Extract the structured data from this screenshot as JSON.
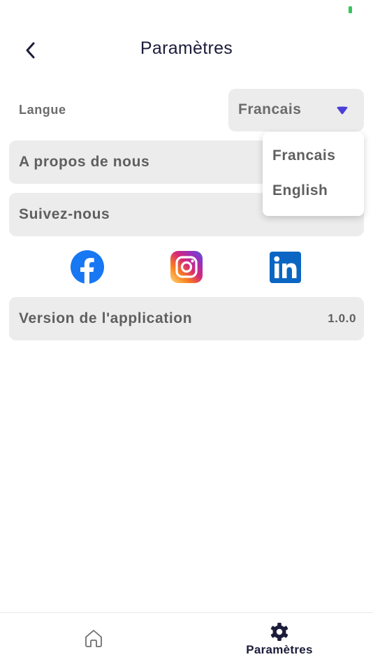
{
  "header": {
    "title": "Paramètres",
    "back_icon": "chevron-left-icon"
  },
  "language": {
    "label": "Langue",
    "selected": "Francais",
    "options": [
      "Francais",
      "English"
    ],
    "accent": "#4b3fd6"
  },
  "rows": {
    "about": "A propos de nous",
    "follow": "Suivez-nous",
    "version_label": "Version de l'application",
    "version_value": "1.0.0"
  },
  "social": [
    {
      "name": "facebook-icon",
      "color": "#1877f2"
    },
    {
      "name": "instagram-icon",
      "color": "#e1306c"
    },
    {
      "name": "linkedin-icon",
      "color": "#0a66c2"
    }
  ],
  "bottom_nav": {
    "home_icon": "home-icon",
    "settings_icon": "gear-icon",
    "settings_label": "Paramètres"
  }
}
